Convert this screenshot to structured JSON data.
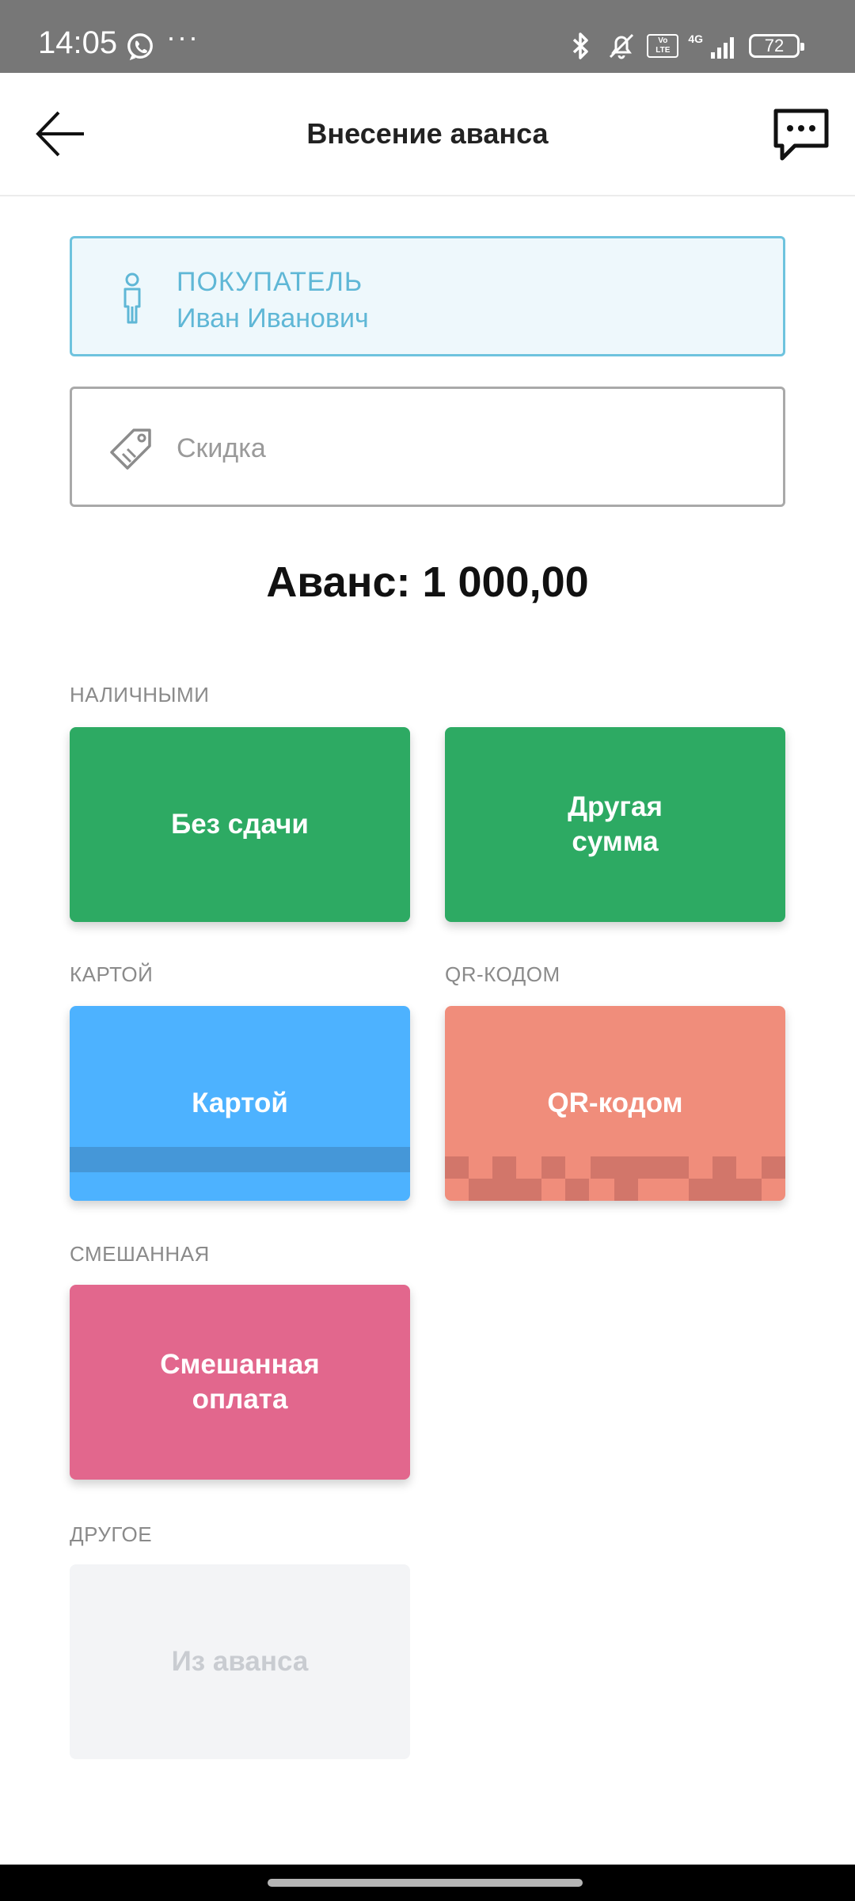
{
  "status_bar": {
    "time": "14:05",
    "more": "···",
    "network": "4G",
    "volte": "Vo\nLTE",
    "battery": "72",
    "icons": [
      "whatsapp-icon",
      "bluetooth-icon",
      "bell-muted-icon",
      "volte-icon",
      "signal-icon",
      "battery-icon"
    ]
  },
  "header": {
    "title": "Внесение аванса",
    "back_icon": "arrow-left-icon",
    "chat_icon": "chat-bubble-icon"
  },
  "buyer": {
    "label": "ПОКУПАТЕЛЬ",
    "name": "Иван Иванович",
    "icon": "person-icon"
  },
  "discount": {
    "placeholder": "Скидка",
    "icon": "price-tag-icon"
  },
  "advance_text": "Аванс: 1 000,00",
  "sections": {
    "cash": {
      "label": "НАЛИЧНЫМИ",
      "no_change": "Без сдачи",
      "other_amount_line1": "Другая",
      "other_amount_line2": "сумма"
    },
    "card": {
      "label": "КАРТОЙ",
      "button": "Картой"
    },
    "qr": {
      "label": "QR-КОДОМ",
      "button": "QR-кодом"
    },
    "mixed": {
      "label": "СМЕШАННАЯ",
      "button_line1": "Смешанная",
      "button_line2": "оплата"
    },
    "other": {
      "label": "ДРУГОЕ",
      "button": "Из аванса"
    }
  },
  "colors": {
    "cash": "#2daa63",
    "card": "#4db2ff",
    "qr": "#f08d7b",
    "mixed": "#e2678d",
    "disabled": "#f3f4f6",
    "buyer_accent": "#5fb7d6"
  }
}
